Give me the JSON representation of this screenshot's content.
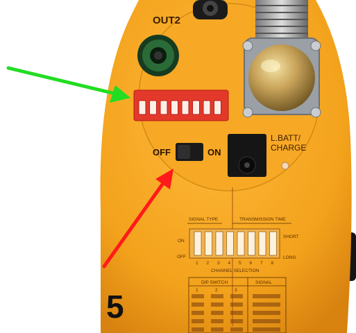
{
  "device": {
    "out2_label": "OUT2",
    "batt_label_line1": "L.BATT/",
    "batt_label_line2": "CHARGE",
    "switch_off_label": "OFF",
    "switch_on_label": "ON",
    "panel": {
      "signal_type": "SIGNAL TYPE",
      "transmission_time": "TRANSMISSION TIME",
      "on": "ON",
      "off": "OFF",
      "short": "SHORT",
      "long": "LONG",
      "channel_selection": "CHANNEL SELECTION",
      "dip_numbers": [
        "1",
        "2",
        "3",
        "4",
        "5",
        "6",
        "7",
        "8"
      ],
      "table_header_left": "DIP SWITCH",
      "table_header_right": "SIGNAL",
      "table_col_numbers": [
        "1",
        "2",
        "3"
      ]
    }
  },
  "annotations": {
    "callout_number": "5",
    "green_arrow_color": "#22dd22",
    "red_arrow_color": "#ff1a1a"
  },
  "colors": {
    "body_orange": "#f5a623",
    "dip_red": "#e8322a",
    "connector_green": "#1f5a2a",
    "brass": "#b8944a"
  }
}
